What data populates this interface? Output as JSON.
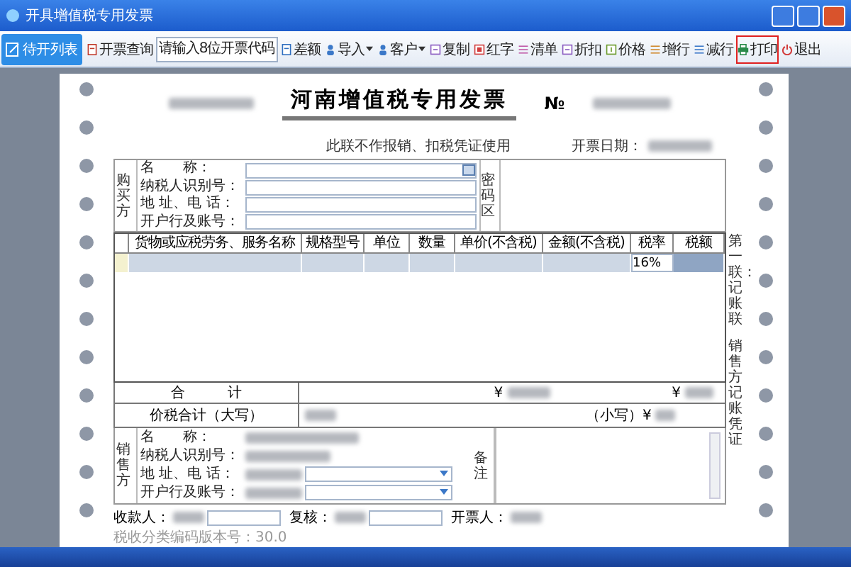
{
  "window": {
    "title": "开具增值税专用发票"
  },
  "toolbar": {
    "list_button": "待开列表",
    "items": [
      {
        "kind": "button",
        "label": "开票查询",
        "highlighted": false
      },
      {
        "kind": "field",
        "placeholder": "请输入8位开票代码"
      },
      {
        "kind": "button",
        "label": "差额",
        "highlighted": false
      },
      {
        "kind": "dropdown",
        "label": "导入",
        "highlighted": false
      },
      {
        "kind": "dropdown",
        "label": "客户",
        "highlighted": false
      },
      {
        "kind": "button",
        "label": "复制",
        "highlighted": false
      },
      {
        "kind": "button",
        "label": "红字",
        "highlighted": false
      },
      {
        "kind": "button",
        "label": "清单",
        "highlighted": false
      },
      {
        "kind": "button",
        "label": "折扣",
        "highlighted": false
      },
      {
        "kind": "button",
        "label": "价格",
        "highlighted": false
      },
      {
        "kind": "button",
        "label": "增行",
        "highlighted": false
      },
      {
        "kind": "button",
        "label": "减行",
        "highlighted": false
      },
      {
        "kind": "button",
        "label": "打印",
        "highlighted": true
      },
      {
        "kind": "button",
        "label": "退出",
        "highlighted": false
      }
    ]
  },
  "invoice": {
    "title": "河南增值税专用发票",
    "number_label": "№",
    "notice": "此联不作报销、扣税凭证使用",
    "date_label": "开票日期：",
    "buyer": {
      "label": "购买方",
      "fields": [
        "名　　称：",
        "纳税人识别号：",
        "地 址、电 话：",
        "开户行及账号："
      ],
      "password_label": "密码区"
    },
    "columns": [
      "货物或应税劳务、服务名称",
      "规格型号",
      "单位",
      "数量",
      "单价(不含税)",
      "金额(不含税)",
      "税率",
      "税额"
    ],
    "rows": [
      {
        "tax_rate": "16%",
        "selected": true
      }
    ],
    "copy_labels": [
      "第一联：记账联",
      "销售方记账凭证"
    ],
    "total_label": "合　　　计",
    "total_amount_symbol": "¥",
    "total_tax_symbol": "¥",
    "grand_total_label": "价税合计（大写）",
    "grand_total_small_label": "（小写）¥",
    "seller": {
      "label": "销售方",
      "fields": [
        "名　　称：",
        "纳税人识别号：",
        "地 址、电 话：",
        "开户行及账号："
      ],
      "remarks_label": "备注"
    },
    "signatures": [
      "收款人：",
      "复核：",
      "开票人："
    ],
    "version": "税收分类编码版本号：30.0"
  }
}
